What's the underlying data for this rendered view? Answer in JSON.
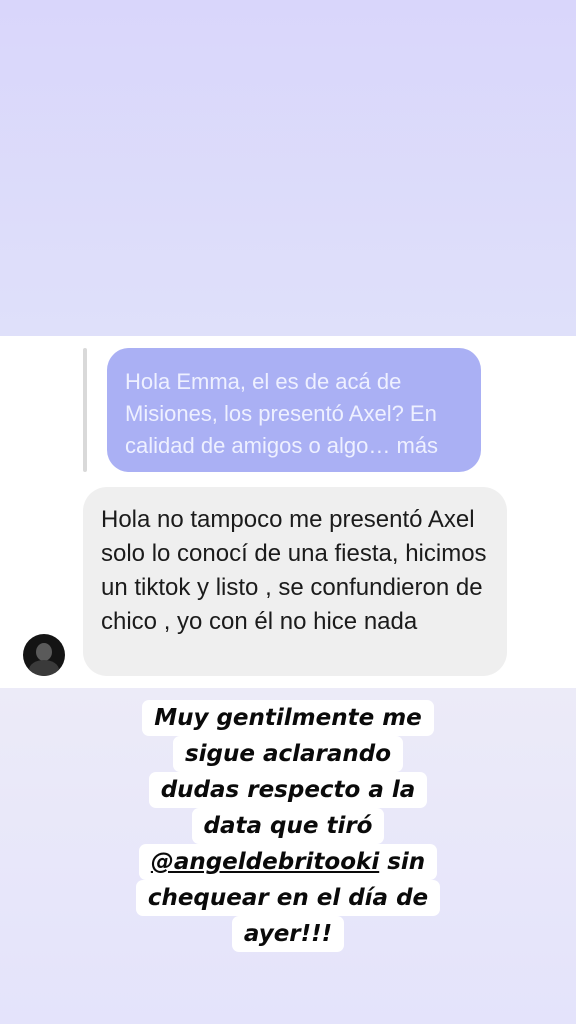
{
  "story": {
    "quoted_message": "Hola Emma, el es de acá de Misiones, los presentó Axel? En calidad de amigos o algo… más",
    "reply_message": "Hola no tampoco me presentó Axel solo lo conocí de una fiesta, hicimos un tiktok y listo , se confundieron de chico , yo con él no hice nada",
    "caption": {
      "line1": "Muy gentilmente me",
      "line2": "sigue aclarando",
      "line3": "dudas respecto a la",
      "line4": "data que tiró",
      "line5_mention": "@angeldebritooki",
      "line5_rest": "sin",
      "line6": "chequear en el día de",
      "line7": "ayer!!!"
    }
  },
  "colors": {
    "quoted_bubble": "#aab0f4",
    "reply_bubble": "#efefef",
    "top_background": "#d9d6fb",
    "bottom_background": "#e4e3fb"
  },
  "icons": {
    "avatar": "profile-avatar"
  }
}
